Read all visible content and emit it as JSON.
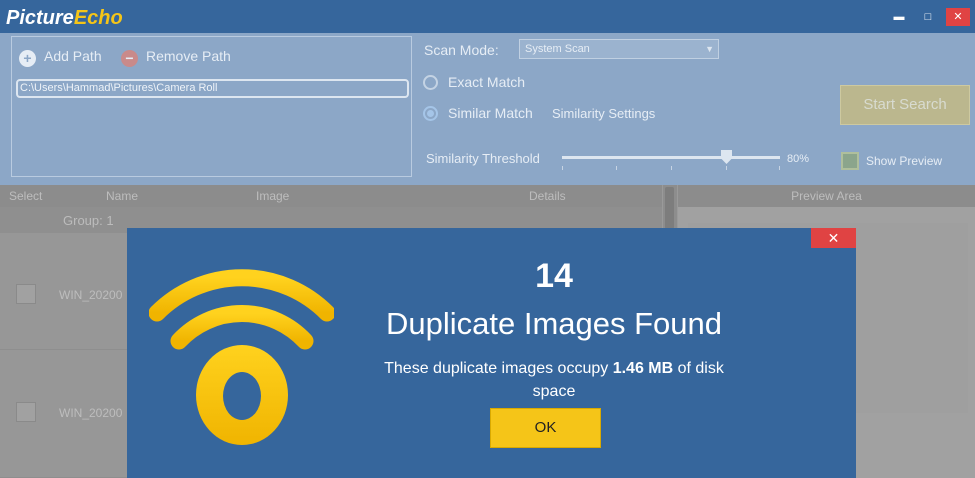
{
  "app": {
    "title_part1": "Picture",
    "title_part2": "Echo",
    "minimize_glyph": "▬",
    "maximize_glyph": "□",
    "close_glyph": "✕"
  },
  "paths": {
    "add_label": "Add Path",
    "remove_label": "Remove Path",
    "items": [
      "C:\\Users\\Hammad\\Pictures\\Camera Roll"
    ]
  },
  "scan": {
    "mode_label": "Scan Mode:",
    "mode_value": "System Scan",
    "exact_match_label": "Exact Match",
    "similar_match_label": "Similar Match",
    "similar_match_selected": true,
    "similarity_settings_label": "Similarity Settings",
    "threshold_label": "Similarity Threshold",
    "threshold_value": 80,
    "threshold_text": "80%",
    "start_search_label": "Start Search",
    "show_preview_label": "Show Preview"
  },
  "results": {
    "columns": [
      "Select",
      "Name",
      "Image",
      "Details"
    ],
    "group_label": "Group: 1",
    "rows": [
      {
        "name": "WIN_20200"
      },
      {
        "name": "WIN_20200"
      }
    ]
  },
  "preview": {
    "header": "Preview Area"
  },
  "dialog": {
    "count": "14",
    "title": "Duplicate Images Found",
    "message_prefix": "These duplicate images occupy ",
    "size": "1.46 MB",
    "message_suffix": " of disk space",
    "ok_label": "OK",
    "close_glyph": "✕",
    "logo_icon": "pictureecho-signal-logo-icon"
  },
  "colors": {
    "titlebar": "#36669c",
    "dialog_bg": "#36669c",
    "accent_yellow": "#f5c518",
    "close_red": "#e04343"
  }
}
